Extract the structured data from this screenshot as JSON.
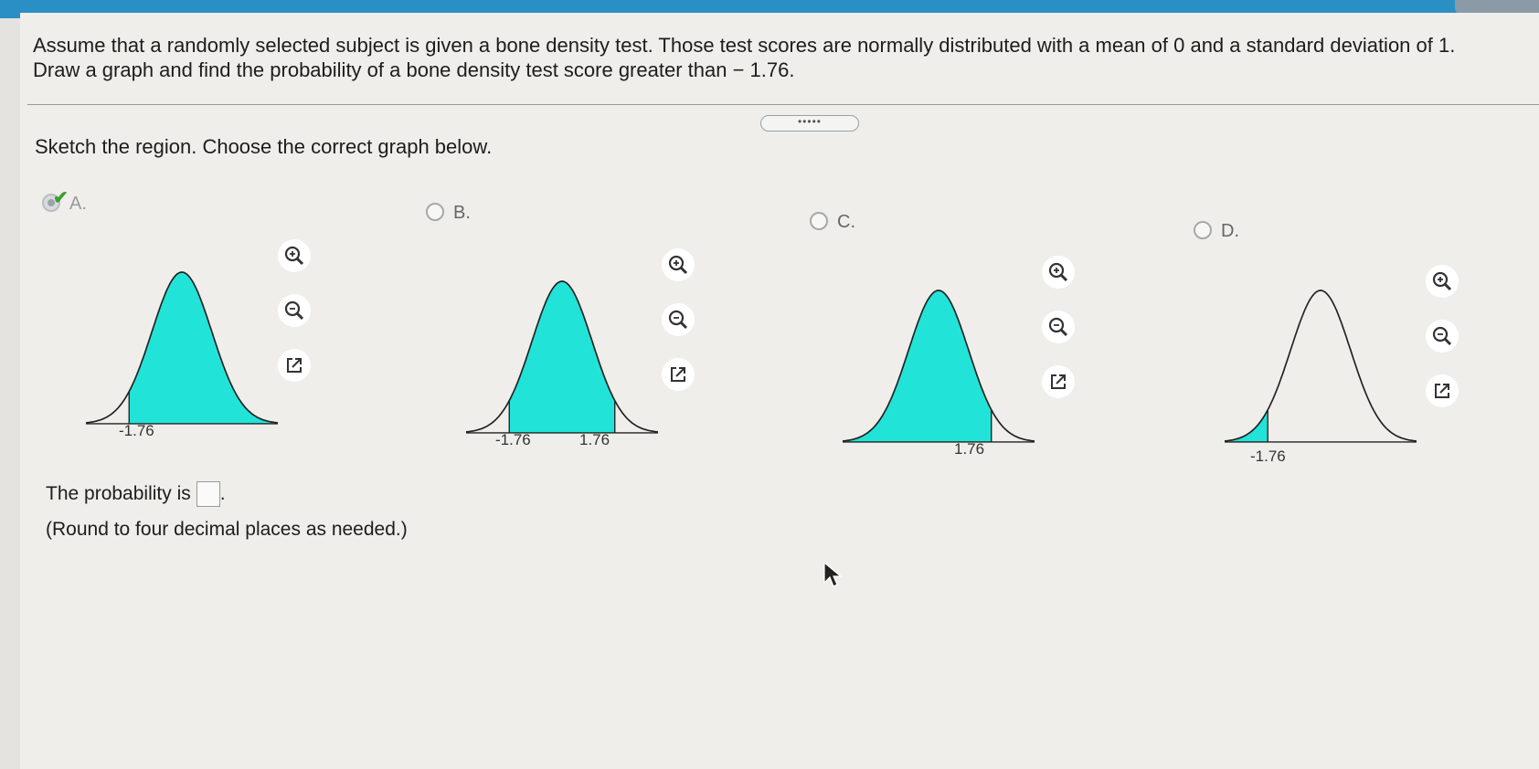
{
  "question": {
    "line1": "Assume that a randomly selected subject is given a bone density test. Those test scores are normally distributed with a mean of 0 and a standard deviation of 1.",
    "line2": "Draw a graph and find the probability of a bone density test score greater than  − 1.76."
  },
  "more_label": "•••••",
  "instruction": "Sketch the region. Choose the correct graph below.",
  "options": [
    {
      "label": "A.",
      "ticks": [
        "-1.76"
      ],
      "selected": true
    },
    {
      "label": "B.",
      "ticks": [
        "-1.76",
        "1.76"
      ],
      "selected": false
    },
    {
      "label": "C.",
      "ticks": [
        "1.76"
      ],
      "selected": false
    },
    {
      "label": "D.",
      "ticks": [
        "-1.76"
      ],
      "selected": false
    }
  ],
  "answer": {
    "prefix": "The probability is",
    "suffix": ".",
    "value": "",
    "hint": "(Round to four decimal places as needed.)"
  },
  "colors": {
    "shade": "#22e3d8",
    "topbar": "#2a8fc4",
    "check": "#3aa02e"
  },
  "icons": [
    "zoom-in-icon",
    "zoom-out-icon",
    "popout-icon",
    "check-icon",
    "cursor-icon"
  ]
}
